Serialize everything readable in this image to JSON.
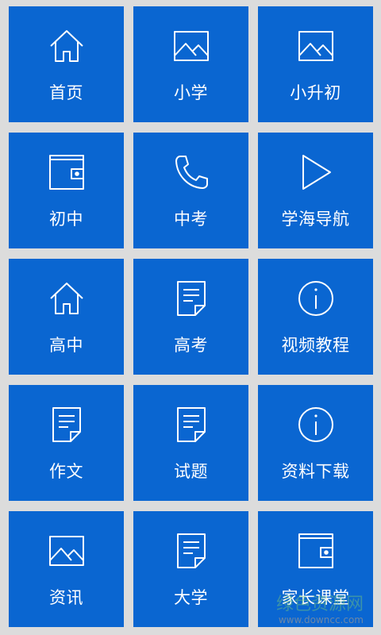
{
  "theme": {
    "tile_color": "#0a66d1",
    "background": "#dcdcdc",
    "text_color": "#ffffff"
  },
  "tiles": [
    {
      "label": "首页",
      "icon": "home-icon"
    },
    {
      "label": "小学",
      "icon": "image-icon"
    },
    {
      "label": "小升初",
      "icon": "image-icon"
    },
    {
      "label": "初中",
      "icon": "wallet-icon"
    },
    {
      "label": "中考",
      "icon": "phone-icon"
    },
    {
      "label": "学海导航",
      "icon": "play-icon"
    },
    {
      "label": "高中",
      "icon": "home-icon"
    },
    {
      "label": "高考",
      "icon": "document-icon"
    },
    {
      "label": "视频教程",
      "icon": "info-icon"
    },
    {
      "label": "作文",
      "icon": "document-icon"
    },
    {
      "label": "试题",
      "icon": "document-icon"
    },
    {
      "label": "资料下载",
      "icon": "info-icon"
    },
    {
      "label": "资讯",
      "icon": "image-icon"
    },
    {
      "label": "大学",
      "icon": "document-icon"
    },
    {
      "label": "家长课堂",
      "icon": "wallet-icon"
    }
  ],
  "watermark": {
    "main": "绿色资源网",
    "url": "www.downcc.com"
  }
}
